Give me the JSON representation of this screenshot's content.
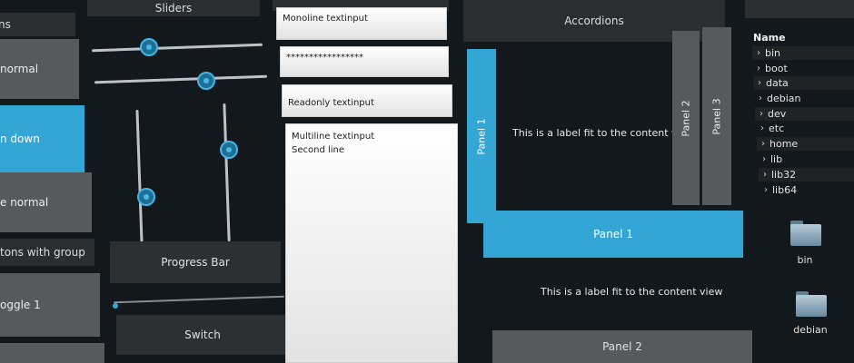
{
  "buttons": {
    "header": "ns",
    "normal": "normal",
    "down": "n down",
    "normal2": "e normal",
    "group_header": "tons with group",
    "toggle": "oggle 1"
  },
  "sliders": {
    "header": "Sliders",
    "h1_value": 0.35,
    "h2_value": 0.6,
    "v1_value": 0.4,
    "v2_value": 0.75
  },
  "progress": {
    "label": "Progress Bar",
    "value": 0.02
  },
  "switch": {
    "label": "Switch"
  },
  "textinputs": {
    "monoline": "Monoline textinput",
    "password": "*****************",
    "readonly": "Readonly textinput",
    "multiline_line1": "Multiline textinput",
    "multiline_line2": "Second line"
  },
  "accordions": {
    "header": "Accordions",
    "panel1": "Panel 1",
    "panel2": "Panel 2",
    "panel3": "Panel 3",
    "content": "This is a label fit to the content view",
    "h_panel1": "Panel 1",
    "h_content": "This is a label fit to the content view",
    "h_panel2": "Panel 2"
  },
  "filechooser": {
    "column_header": "Name",
    "items": [
      "bin",
      "boot",
      "data",
      "debian",
      "dev",
      "etc",
      "home",
      "lib",
      "lib32",
      "lib64"
    ],
    "icons": [
      "bin",
      "debian"
    ]
  },
  "colors": {
    "accent": "#33a6d6",
    "background": "#13181c",
    "button": "#58595b"
  }
}
